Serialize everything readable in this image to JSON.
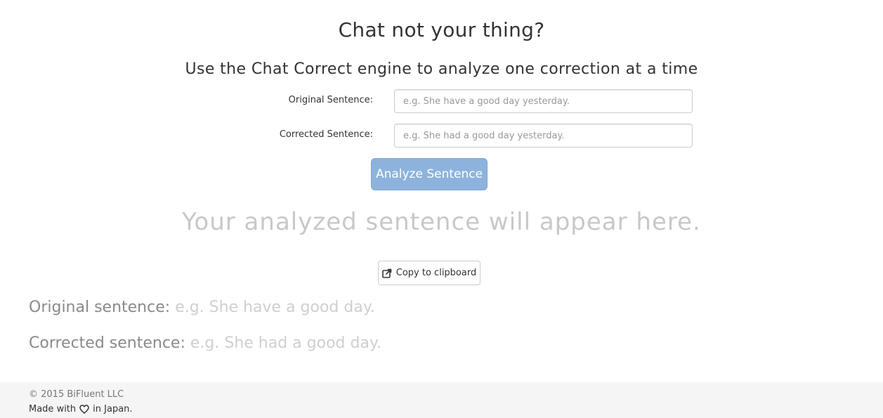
{
  "header": {
    "title": "Chat not your thing?",
    "subtitle": "Use the Chat Correct engine to analyze one correction at a time"
  },
  "form": {
    "original_label": "Original Sentence:",
    "original_placeholder": "e.g. She have a good day yesterday.",
    "original_value": "",
    "corrected_label": "Corrected Sentence:",
    "corrected_placeholder": "e.g. She had a good day yesterday.",
    "corrected_value": "",
    "analyze_button": "Analyze Sentence"
  },
  "result": {
    "placeholder": "Your analyzed sentence will appear here.",
    "copy_button": "Copy to clipboard",
    "copy_icon": "share-icon"
  },
  "examples": {
    "original_label": "Original sentence",
    "original_value": "e.g. She have a good day.",
    "corrected_label": "Corrected sentence",
    "corrected_value": "e.g. She had a good day.",
    "separator": ":"
  },
  "footer": {
    "copyright": "© 2015 BiFluent LLC",
    "made_prefix": "Made with",
    "made_icon": "heart-icon",
    "made_suffix": "in Japan."
  },
  "colors": {
    "primary_button": "#8db3dd",
    "placeholder_text": "#c8c8c8",
    "footer_bg": "#f5f5f5"
  }
}
